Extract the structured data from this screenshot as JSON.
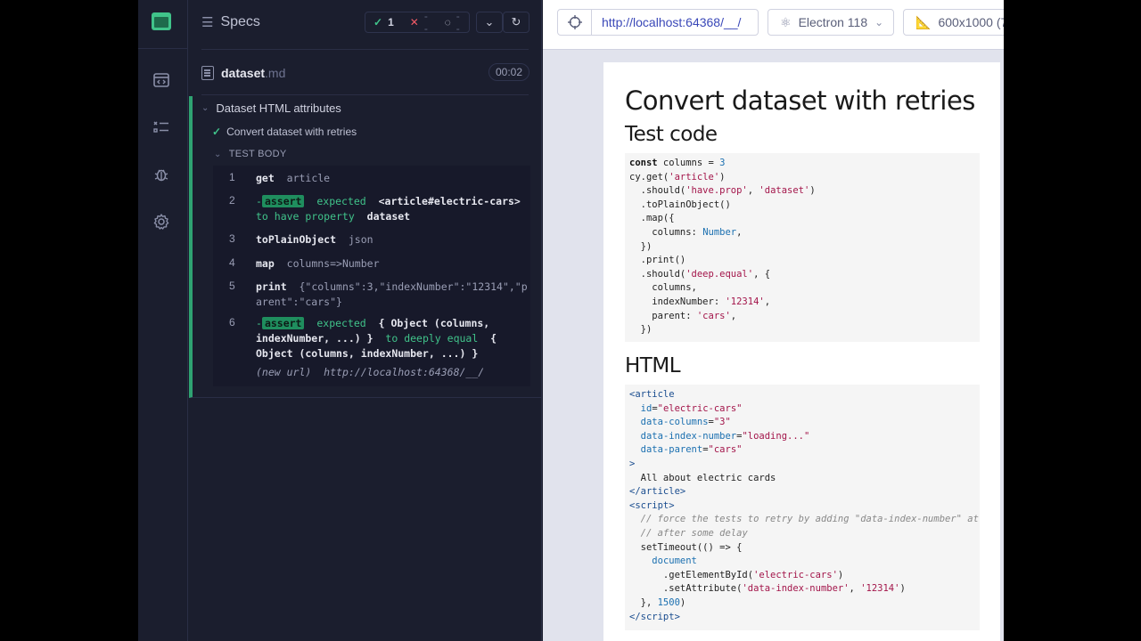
{
  "reporter": {
    "specs_label": "Specs",
    "stats": {
      "passed": "1",
      "failed": "--",
      "pending": "--"
    },
    "file": {
      "name": "dataset",
      "ext": ".md",
      "duration": "00:02"
    },
    "suite_title": "Dataset HTML attributes",
    "test_title": "Convert dataset with retries",
    "test_body_label": "TEST BODY",
    "commands": [
      {
        "num": "1",
        "name": "get",
        "arg": "article"
      },
      {
        "num": "2",
        "badge": "assert",
        "line1_a": "expected",
        "line1_b": "<article#electric-cars>",
        "line2_a": "to have property",
        "line2_b": "dataset"
      },
      {
        "num": "3",
        "name": "toPlainObject",
        "arg": "json"
      },
      {
        "num": "4",
        "name": "map",
        "arg": "columns=>Number"
      },
      {
        "num": "5",
        "name": "print",
        "arg_line1": "{\"columns\":3,\"indexNumber\":\"12314\",\"p",
        "arg_line2": "arent\":\"cars\"}"
      },
      {
        "num": "6",
        "badge": "assert",
        "l1_a": "expected",
        "l1_b": "{ Object (columns,",
        "l2_a": "indexNumber, ...) }",
        "l2_b": "to deeply equal",
        "l2_c": "{",
        "l3_a": "Object (columns, indexNumber, ...) }"
      }
    ],
    "new_url_label": "(new url)",
    "new_url": "http://localhost:64368/__/"
  },
  "toolbar": {
    "url": "http://localhost:64368/__/",
    "browser": "Electron 118",
    "viewport": "600x1000 (7"
  },
  "page": {
    "title": "Convert dataset with retries",
    "h2_test_code": "Test code",
    "h2_html": "HTML"
  }
}
